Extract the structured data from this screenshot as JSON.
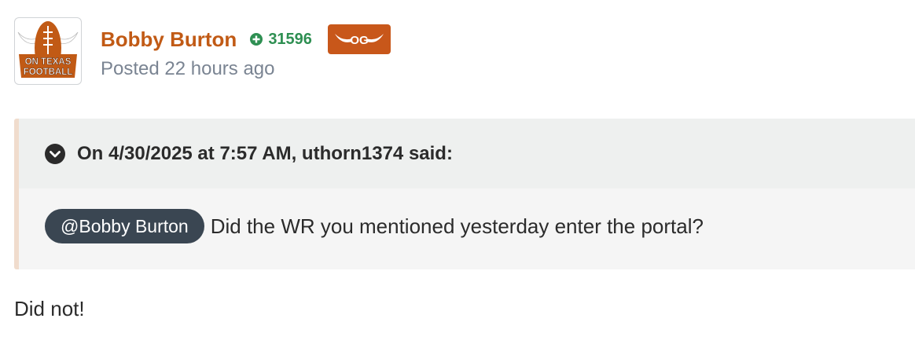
{
  "author": {
    "name": "Bobby Burton",
    "avatar_text_top": "ON TEXAS",
    "avatar_text_bottom": "FOOTBALL",
    "avatar_icon": "football-logo-icon",
    "reputation": "31596",
    "reputation_icon": "plus-circle-icon",
    "badge_icon": "og-longhorn-badge-icon",
    "badge_text": "OG",
    "posted": "Posted 22 hours ago"
  },
  "quote": {
    "toggle_icon": "chevron-down-circle-icon",
    "citation": "On 4/30/2025 at 7:57 AM, uthorn1374 said:",
    "mention": "@Bobby Burton",
    "text": "Did the WR you mentioned yesterday enter the portal?"
  },
  "reply": "Did not!",
  "colors": {
    "author": "#c15a15",
    "reputation": "#2e8f52",
    "badge": "#c8571a",
    "mention_bg": "#3a4652",
    "quote_border": "#f0dccd"
  }
}
